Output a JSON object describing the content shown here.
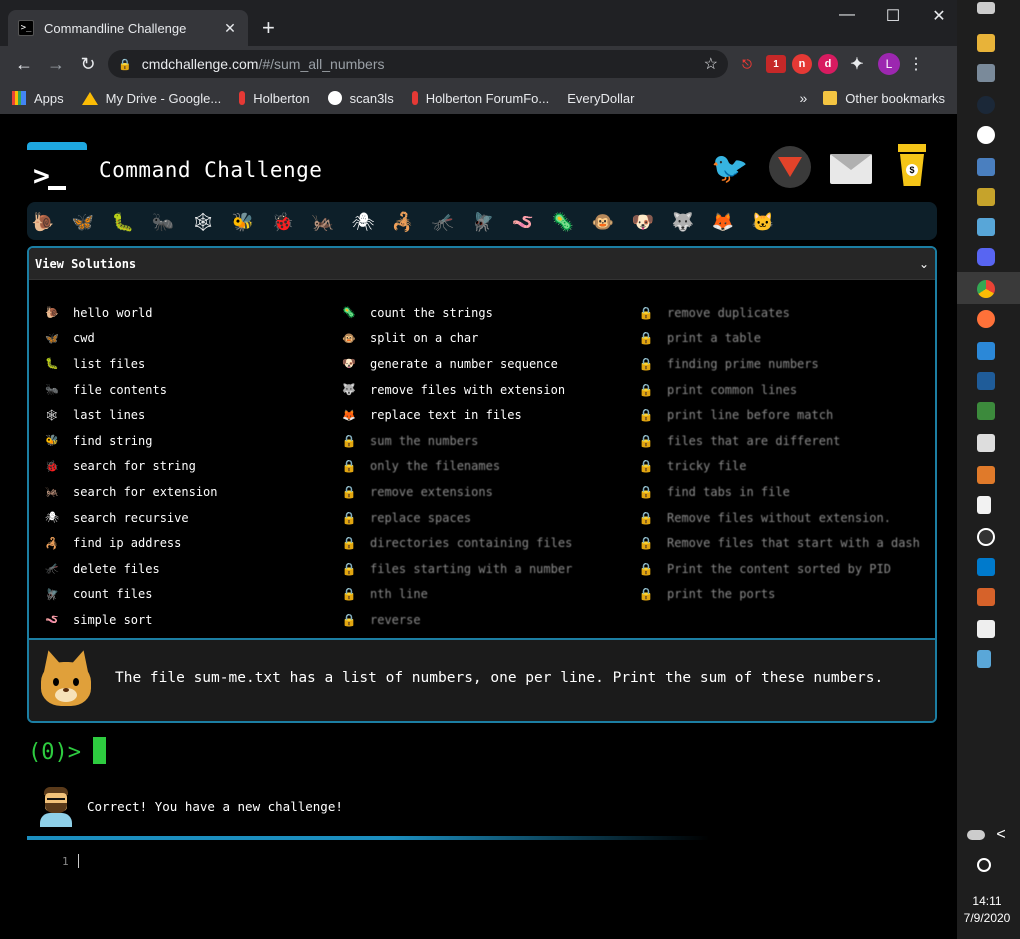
{
  "browser": {
    "tab_title": "Commandline Challenge",
    "tab_favicon": ">_",
    "tab_close": "✕",
    "new_tab": "+",
    "window_controls": [
      "—",
      "☐",
      "✕"
    ],
    "url_host": "cmdchallenge.com",
    "url_path": "/#/sum_all_numbers",
    "extension_badge": "1",
    "extension_n": "n",
    "extension_d": "d",
    "profile_initial": "L",
    "bookmarks": [
      {
        "label": "Apps",
        "icon": "apps-grid-icon"
      },
      {
        "label": "My Drive - Google...",
        "icon": "google-drive-icon"
      },
      {
        "label": "Holberton",
        "icon": "holberton-icon"
      },
      {
        "label": "scan3ls",
        "icon": "github-icon"
      },
      {
        "label": "Holberton ForumFo...",
        "icon": "holberton-icon"
      },
      {
        "label": "EveryDollar",
        "icon": ""
      }
    ],
    "bookmarks_overflow": "»",
    "other_bookmarks": "Other bookmarks"
  },
  "taskbar": {
    "time": "14:11",
    "date": "7/9/2020",
    "tray_chevron": "<"
  },
  "site": {
    "title": "Command Challenge",
    "coffee_label": "$",
    "critters": [
      "🐌",
      "🦋",
      "🐛",
      "🐜",
      "🕸",
      "🐝",
      "🐞",
      "🦗",
      "🕷",
      "🦂",
      "🦟",
      "🪰",
      "🪱",
      "🦠",
      "🐵",
      "🐶",
      "🐺",
      "🦊",
      "🐱"
    ]
  },
  "solutions": {
    "header": "View Solutions",
    "chevron": "⌄",
    "columns": [
      [
        {
          "icon": "🐌",
          "label": "hello world",
          "locked": false
        },
        {
          "icon": "🦋",
          "label": "cwd",
          "locked": false
        },
        {
          "icon": "🐛",
          "label": "list files",
          "locked": false
        },
        {
          "icon": "🐜",
          "label": "file contents",
          "locked": false
        },
        {
          "icon": "🕸",
          "label": "last lines",
          "locked": false
        },
        {
          "icon": "🐝",
          "label": "find string",
          "locked": false
        },
        {
          "icon": "🐞",
          "label": "search for string",
          "locked": false
        },
        {
          "icon": "🦗",
          "label": "search for extension",
          "locked": false
        },
        {
          "icon": "🕷",
          "label": "search recursive",
          "locked": false
        },
        {
          "icon": "🦂",
          "label": "find ip address",
          "locked": false
        },
        {
          "icon": "🦟",
          "label": "delete files",
          "locked": false
        },
        {
          "icon": "🪰",
          "label": "count files",
          "locked": false
        },
        {
          "icon": "🪱",
          "label": "simple sort",
          "locked": false
        }
      ],
      [
        {
          "icon": "🦠",
          "label": "count the strings",
          "locked": false
        },
        {
          "icon": "🐵",
          "label": "split on a char",
          "locked": false
        },
        {
          "icon": "🐶",
          "label": "generate a number sequence",
          "locked": false
        },
        {
          "icon": "🐺",
          "label": "remove files with extension",
          "locked": false
        },
        {
          "icon": "🦊",
          "label": "replace text in files",
          "locked": false
        },
        {
          "icon": "🔒",
          "label": "sum the numbers",
          "locked": true
        },
        {
          "icon": "🔒",
          "label": "only the filenames",
          "locked": true
        },
        {
          "icon": "🔒",
          "label": "remove extensions",
          "locked": true
        },
        {
          "icon": "🔒",
          "label": "replace spaces",
          "locked": true
        },
        {
          "icon": "🔒",
          "label": "directories containing files",
          "locked": true
        },
        {
          "icon": "🔒",
          "label": "files starting with a number",
          "locked": true
        },
        {
          "icon": "🔒",
          "label": "nth line",
          "locked": true
        },
        {
          "icon": "🔒",
          "label": "reverse",
          "locked": true
        }
      ],
      [
        {
          "icon": "🔒",
          "label": "remove duplicates",
          "locked": true
        },
        {
          "icon": "🔒",
          "label": "print a table",
          "locked": true
        },
        {
          "icon": "🔒",
          "label": "finding prime numbers",
          "locked": true
        },
        {
          "icon": "🔒",
          "label": "print common lines",
          "locked": true
        },
        {
          "icon": "🔒",
          "label": "print line before match",
          "locked": true
        },
        {
          "icon": "🔒",
          "label": "files that are different",
          "locked": true
        },
        {
          "icon": "🔒",
          "label": "tricky file",
          "locked": true
        },
        {
          "icon": "🔒",
          "label": "find tabs in file",
          "locked": true
        },
        {
          "icon": "🔒",
          "label": "Remove files without extension.",
          "locked": true
        },
        {
          "icon": "🔒",
          "label": "Remove files that start with a dash",
          "locked": true
        },
        {
          "icon": "🔒",
          "label": "Print the content sorted by PID",
          "locked": true
        },
        {
          "icon": "🔒",
          "label": "print the ports",
          "locked": true
        }
      ]
    ]
  },
  "challenge": {
    "text": "The file sum-me.txt has a list of numbers, one per line. Print the sum of these numbers."
  },
  "terminal": {
    "prompt": "(0)>",
    "bot_message": "Correct! You have a new challenge!",
    "editor_line": "1"
  },
  "colors": {
    "accent": "#1c7ea3",
    "prompt_green": "#2ecc40",
    "lock_yellow": "#f5d000"
  }
}
